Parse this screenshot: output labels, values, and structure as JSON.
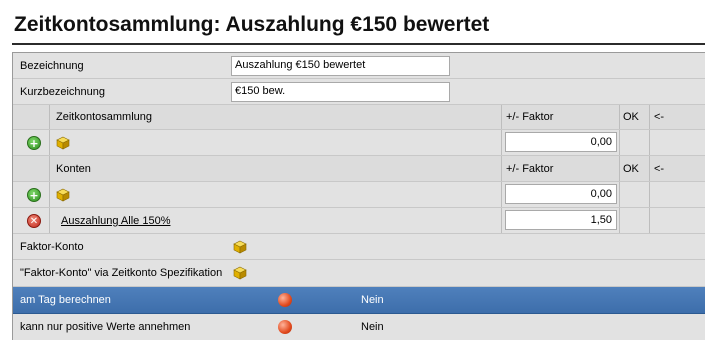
{
  "title": "Zeitkontosammlung: Auszahlung €150 bewertet",
  "fields": {
    "bezeichnung_label": "Bezeichnung",
    "bezeichnung_value": "Auszahlung €150 bewertet",
    "kurzbezeichnung_label": "Kurzbezeichnung",
    "kurzbezeichnung_value": "€150 bew."
  },
  "zeitkontosammlung": {
    "header": "Zeitkontosammlung",
    "faktor_header": "+/- Faktor",
    "ok_header": "OK",
    "arrow_header": "<-",
    "new_row_value": "0,00"
  },
  "konten": {
    "header": "Konten",
    "faktor_header": "+/- Faktor",
    "ok_header": "OK",
    "arrow_header": "<-",
    "new_row_value": "0,00",
    "rows": [
      {
        "name": "Auszahlung Alle 150%",
        "faktor": "1,50"
      }
    ]
  },
  "faktor_konto_label": "Faktor-Konto",
  "faktor_konto_spez_label": "\"Faktor-Konto\" via Zeitkonto Spezifikation",
  "options": [
    {
      "label": "am Tag berechnen",
      "value": "Nein",
      "selected": true
    },
    {
      "label": "kann nur positive Werte annehmen",
      "value": "Nein",
      "selected": false
    }
  ],
  "icons": {
    "add": "plus-circle-icon",
    "delete": "x-circle-icon",
    "cube": "cube-icon",
    "status": "red-orb-icon"
  },
  "colors": {
    "selected_row": "#4a7bb7",
    "add_green": "#3fa52c",
    "delete_red": "#d2301f",
    "cube_yellow": "#e6b400"
  }
}
